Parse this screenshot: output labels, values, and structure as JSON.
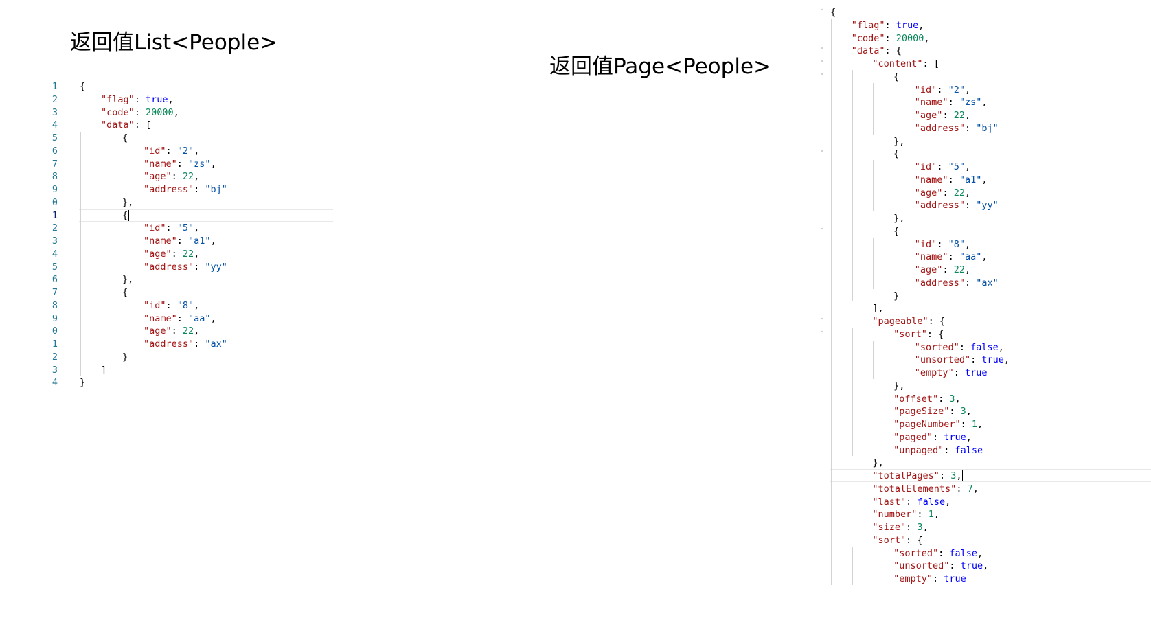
{
  "titles": {
    "list": "返回值List<People>",
    "page": "返回值Page<People>"
  },
  "colors": {
    "key": "#a31515",
    "string": "#0451a5",
    "number": "#098658",
    "boolean": "#0000ff",
    "line_number": "#237893",
    "indent_guide": "#d3d3d3"
  },
  "list_editor": {
    "line_numbers": [
      "1",
      "2",
      "3",
      "4",
      "5",
      "6",
      "7",
      "8",
      "9",
      "0",
      "1",
      "2",
      "3",
      "4",
      "5",
      "6",
      "7",
      "8",
      "9",
      "0",
      "1",
      "2",
      "3",
      "4"
    ],
    "active_line_index": 10,
    "lines": [
      [
        {
          "t": "p",
          "v": "{"
        }
      ],
      [
        {
          "t": "k",
          "v": "\"flag\""
        },
        {
          "t": "p",
          "v": ": "
        },
        {
          "t": "b",
          "v": "true"
        },
        {
          "t": "p",
          "v": ","
        }
      ],
      [
        {
          "t": "k",
          "v": "\"code\""
        },
        {
          "t": "p",
          "v": ": "
        },
        {
          "t": "n",
          "v": "20000"
        },
        {
          "t": "p",
          "v": ","
        }
      ],
      [
        {
          "t": "k",
          "v": "\"data\""
        },
        {
          "t": "p",
          "v": ": ["
        }
      ],
      [
        {
          "t": "p",
          "v": "{"
        }
      ],
      [
        {
          "t": "k",
          "v": "\"id\""
        },
        {
          "t": "p",
          "v": ": "
        },
        {
          "t": "s",
          "v": "\"2\""
        },
        {
          "t": "p",
          "v": ","
        }
      ],
      [
        {
          "t": "k",
          "v": "\"name\""
        },
        {
          "t": "p",
          "v": ": "
        },
        {
          "t": "s",
          "v": "\"zs\""
        },
        {
          "t": "p",
          "v": ","
        }
      ],
      [
        {
          "t": "k",
          "v": "\"age\""
        },
        {
          "t": "p",
          "v": ": "
        },
        {
          "t": "n",
          "v": "22"
        },
        {
          "t": "p",
          "v": ","
        }
      ],
      [
        {
          "t": "k",
          "v": "\"address\""
        },
        {
          "t": "p",
          "v": ": "
        },
        {
          "t": "s",
          "v": "\"bj\""
        }
      ],
      [
        {
          "t": "p",
          "v": "},"
        }
      ],
      [
        {
          "t": "p",
          "v": "{"
        }
      ],
      [
        {
          "t": "k",
          "v": "\"id\""
        },
        {
          "t": "p",
          "v": ": "
        },
        {
          "t": "s",
          "v": "\"5\""
        },
        {
          "t": "p",
          "v": ","
        }
      ],
      [
        {
          "t": "k",
          "v": "\"name\""
        },
        {
          "t": "p",
          "v": ": "
        },
        {
          "t": "s",
          "v": "\"a1\""
        },
        {
          "t": "p",
          "v": ","
        }
      ],
      [
        {
          "t": "k",
          "v": "\"age\""
        },
        {
          "t": "p",
          "v": ": "
        },
        {
          "t": "n",
          "v": "22"
        },
        {
          "t": "p",
          "v": ","
        }
      ],
      [
        {
          "t": "k",
          "v": "\"address\""
        },
        {
          "t": "p",
          "v": ": "
        },
        {
          "t": "s",
          "v": "\"yy\""
        }
      ],
      [
        {
          "t": "p",
          "v": "},"
        }
      ],
      [
        {
          "t": "p",
          "v": "{"
        }
      ],
      [
        {
          "t": "k",
          "v": "\"id\""
        },
        {
          "t": "p",
          "v": ": "
        },
        {
          "t": "s",
          "v": "\"8\""
        },
        {
          "t": "p",
          "v": ","
        }
      ],
      [
        {
          "t": "k",
          "v": "\"name\""
        },
        {
          "t": "p",
          "v": ": "
        },
        {
          "t": "s",
          "v": "\"aa\""
        },
        {
          "t": "p",
          "v": ","
        }
      ],
      [
        {
          "t": "k",
          "v": "\"age\""
        },
        {
          "t": "p",
          "v": ": "
        },
        {
          "t": "n",
          "v": "22"
        },
        {
          "t": "p",
          "v": ","
        }
      ],
      [
        {
          "t": "k",
          "v": "\"address\""
        },
        {
          "t": "p",
          "v": ": "
        },
        {
          "t": "s",
          "v": "\"ax\""
        }
      ],
      [
        {
          "t": "p",
          "v": "}"
        }
      ],
      [
        {
          "t": "p",
          "v": "]"
        }
      ],
      [
        {
          "t": "p",
          "v": "}"
        }
      ]
    ],
    "indents": [
      0,
      1,
      1,
      1,
      2,
      3,
      3,
      3,
      3,
      2,
      2,
      3,
      3,
      3,
      3,
      2,
      2,
      3,
      3,
      3,
      3,
      2,
      1,
      0
    ]
  },
  "page_editor": {
    "cursor_line_index": 36,
    "lines": [
      [
        {
          "t": "p",
          "v": "{"
        }
      ],
      [
        {
          "t": "k",
          "v": "\"flag\""
        },
        {
          "t": "p",
          "v": ": "
        },
        {
          "t": "b",
          "v": "true"
        },
        {
          "t": "p",
          "v": ","
        }
      ],
      [
        {
          "t": "k",
          "v": "\"code\""
        },
        {
          "t": "p",
          "v": ": "
        },
        {
          "t": "n",
          "v": "20000"
        },
        {
          "t": "p",
          "v": ","
        }
      ],
      [
        {
          "t": "k",
          "v": "\"data\""
        },
        {
          "t": "p",
          "v": ": {"
        }
      ],
      [
        {
          "t": "k",
          "v": "\"content\""
        },
        {
          "t": "p",
          "v": ": ["
        }
      ],
      [
        {
          "t": "p",
          "v": "{"
        }
      ],
      [
        {
          "t": "k",
          "v": "\"id\""
        },
        {
          "t": "p",
          "v": ": "
        },
        {
          "t": "s",
          "v": "\"2\""
        },
        {
          "t": "p",
          "v": ","
        }
      ],
      [
        {
          "t": "k",
          "v": "\"name\""
        },
        {
          "t": "p",
          "v": ": "
        },
        {
          "t": "s",
          "v": "\"zs\""
        },
        {
          "t": "p",
          "v": ","
        }
      ],
      [
        {
          "t": "k",
          "v": "\"age\""
        },
        {
          "t": "p",
          "v": ": "
        },
        {
          "t": "n",
          "v": "22"
        },
        {
          "t": "p",
          "v": ","
        }
      ],
      [
        {
          "t": "k",
          "v": "\"address\""
        },
        {
          "t": "p",
          "v": ": "
        },
        {
          "t": "s",
          "v": "\"bj\""
        }
      ],
      [
        {
          "t": "p",
          "v": "},"
        }
      ],
      [
        {
          "t": "p",
          "v": "{"
        }
      ],
      [
        {
          "t": "k",
          "v": "\"id\""
        },
        {
          "t": "p",
          "v": ": "
        },
        {
          "t": "s",
          "v": "\"5\""
        },
        {
          "t": "p",
          "v": ","
        }
      ],
      [
        {
          "t": "k",
          "v": "\"name\""
        },
        {
          "t": "p",
          "v": ": "
        },
        {
          "t": "s",
          "v": "\"a1\""
        },
        {
          "t": "p",
          "v": ","
        }
      ],
      [
        {
          "t": "k",
          "v": "\"age\""
        },
        {
          "t": "p",
          "v": ": "
        },
        {
          "t": "n",
          "v": "22"
        },
        {
          "t": "p",
          "v": ","
        }
      ],
      [
        {
          "t": "k",
          "v": "\"address\""
        },
        {
          "t": "p",
          "v": ": "
        },
        {
          "t": "s",
          "v": "\"yy\""
        }
      ],
      [
        {
          "t": "p",
          "v": "},"
        }
      ],
      [
        {
          "t": "p",
          "v": "{"
        }
      ],
      [
        {
          "t": "k",
          "v": "\"id\""
        },
        {
          "t": "p",
          "v": ": "
        },
        {
          "t": "s",
          "v": "\"8\""
        },
        {
          "t": "p",
          "v": ","
        }
      ],
      [
        {
          "t": "k",
          "v": "\"name\""
        },
        {
          "t": "p",
          "v": ": "
        },
        {
          "t": "s",
          "v": "\"aa\""
        },
        {
          "t": "p",
          "v": ","
        }
      ],
      [
        {
          "t": "k",
          "v": "\"age\""
        },
        {
          "t": "p",
          "v": ": "
        },
        {
          "t": "n",
          "v": "22"
        },
        {
          "t": "p",
          "v": ","
        }
      ],
      [
        {
          "t": "k",
          "v": "\"address\""
        },
        {
          "t": "p",
          "v": ": "
        },
        {
          "t": "s",
          "v": "\"ax\""
        }
      ],
      [
        {
          "t": "p",
          "v": "}"
        }
      ],
      [
        {
          "t": "p",
          "v": "],"
        }
      ],
      [
        {
          "t": "k",
          "v": "\"pageable\""
        },
        {
          "t": "p",
          "v": ": {"
        }
      ],
      [
        {
          "t": "k",
          "v": "\"sort\""
        },
        {
          "t": "p",
          "v": ": {"
        }
      ],
      [
        {
          "t": "k",
          "v": "\"sorted\""
        },
        {
          "t": "p",
          "v": ": "
        },
        {
          "t": "b",
          "v": "false"
        },
        {
          "t": "p",
          "v": ","
        }
      ],
      [
        {
          "t": "k",
          "v": "\"unsorted\""
        },
        {
          "t": "p",
          "v": ": "
        },
        {
          "t": "b",
          "v": "true"
        },
        {
          "t": "p",
          "v": ","
        }
      ],
      [
        {
          "t": "k",
          "v": "\"empty\""
        },
        {
          "t": "p",
          "v": ": "
        },
        {
          "t": "b",
          "v": "true"
        }
      ],
      [
        {
          "t": "p",
          "v": "},"
        }
      ],
      [
        {
          "t": "k",
          "v": "\"offset\""
        },
        {
          "t": "p",
          "v": ": "
        },
        {
          "t": "n",
          "v": "3"
        },
        {
          "t": "p",
          "v": ","
        }
      ],
      [
        {
          "t": "k",
          "v": "\"pageSize\""
        },
        {
          "t": "p",
          "v": ": "
        },
        {
          "t": "n",
          "v": "3"
        },
        {
          "t": "p",
          "v": ","
        }
      ],
      [
        {
          "t": "k",
          "v": "\"pageNumber\""
        },
        {
          "t": "p",
          "v": ": "
        },
        {
          "t": "n",
          "v": "1"
        },
        {
          "t": "p",
          "v": ","
        }
      ],
      [
        {
          "t": "k",
          "v": "\"paged\""
        },
        {
          "t": "p",
          "v": ": "
        },
        {
          "t": "b",
          "v": "true"
        },
        {
          "t": "p",
          "v": ","
        }
      ],
      [
        {
          "t": "k",
          "v": "\"unpaged\""
        },
        {
          "t": "p",
          "v": ": "
        },
        {
          "t": "b",
          "v": "false"
        }
      ],
      [
        {
          "t": "p",
          "v": "},"
        }
      ],
      [
        {
          "t": "k",
          "v": "\"totalPages\""
        },
        {
          "t": "p",
          "v": ": "
        },
        {
          "t": "n",
          "v": "3"
        },
        {
          "t": "p",
          "v": ","
        }
      ],
      [
        {
          "t": "k",
          "v": "\"totalElements\""
        },
        {
          "t": "p",
          "v": ": "
        },
        {
          "t": "n",
          "v": "7"
        },
        {
          "t": "p",
          "v": ","
        }
      ],
      [
        {
          "t": "k",
          "v": "\"last\""
        },
        {
          "t": "p",
          "v": ": "
        },
        {
          "t": "b",
          "v": "false"
        },
        {
          "t": "p",
          "v": ","
        }
      ],
      [
        {
          "t": "k",
          "v": "\"number\""
        },
        {
          "t": "p",
          "v": ": "
        },
        {
          "t": "n",
          "v": "1"
        },
        {
          "t": "p",
          "v": ","
        }
      ],
      [
        {
          "t": "k",
          "v": "\"size\""
        },
        {
          "t": "p",
          "v": ": "
        },
        {
          "t": "n",
          "v": "3"
        },
        {
          "t": "p",
          "v": ","
        }
      ],
      [
        {
          "t": "k",
          "v": "\"sort\""
        },
        {
          "t": "p",
          "v": ": {"
        }
      ],
      [
        {
          "t": "k",
          "v": "\"sorted\""
        },
        {
          "t": "p",
          "v": ": "
        },
        {
          "t": "b",
          "v": "false"
        },
        {
          "t": "p",
          "v": ","
        }
      ],
      [
        {
          "t": "k",
          "v": "\"unsorted\""
        },
        {
          "t": "p",
          "v": ": "
        },
        {
          "t": "b",
          "v": "true"
        },
        {
          "t": "p",
          "v": ","
        }
      ],
      [
        {
          "t": "k",
          "v": "\"empty\""
        },
        {
          "t": "p",
          "v": ": "
        },
        {
          "t": "b",
          "v": "true"
        }
      ]
    ],
    "indents": [
      0,
      1,
      1,
      1,
      2,
      3,
      4,
      4,
      4,
      4,
      3,
      3,
      4,
      4,
      4,
      4,
      3,
      3,
      4,
      4,
      4,
      4,
      3,
      2,
      2,
      3,
      4,
      4,
      4,
      3,
      3,
      3,
      3,
      3,
      3,
      2,
      2,
      2,
      2,
      2,
      2,
      2,
      3,
      3,
      3
    ],
    "fold_lines": [
      0,
      3,
      4,
      5,
      11,
      17,
      24,
      25
    ]
  }
}
